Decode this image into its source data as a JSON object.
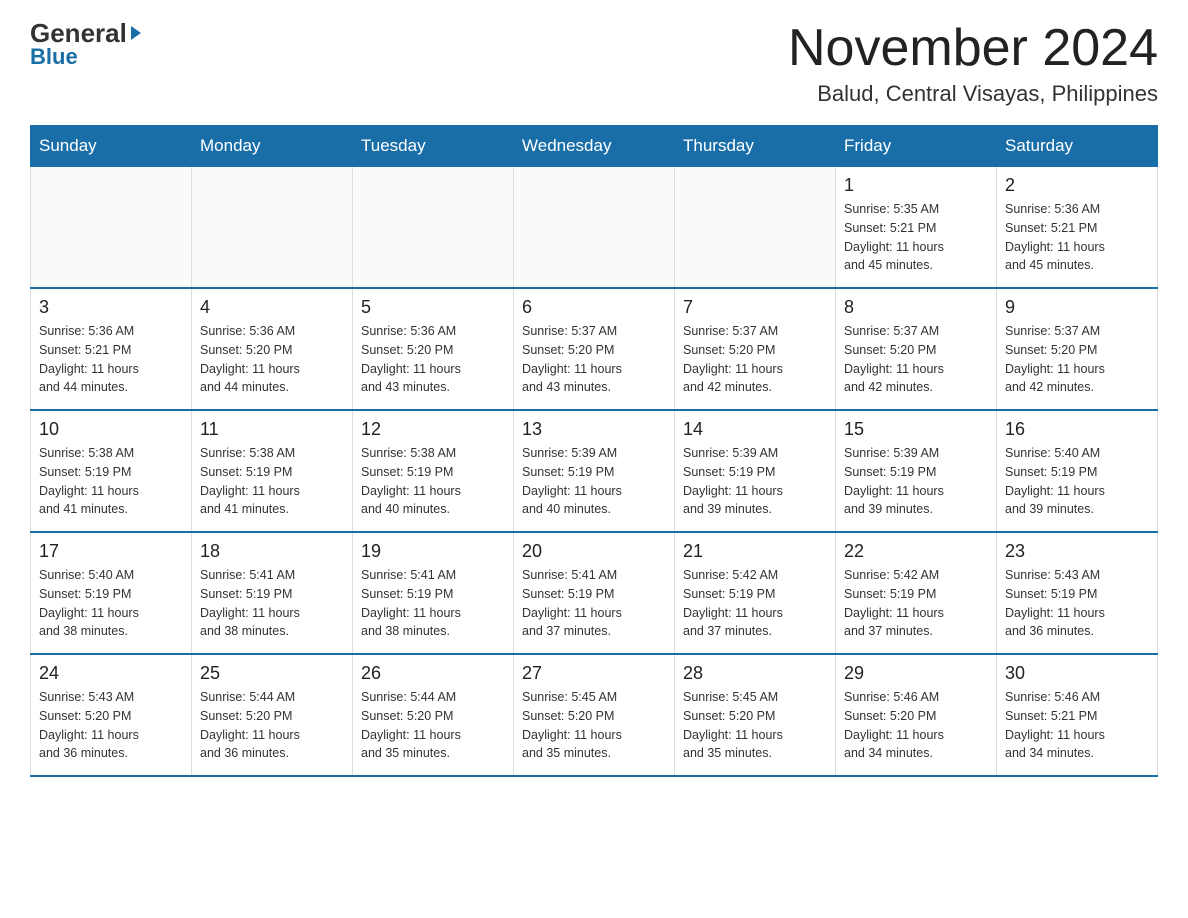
{
  "header": {
    "title": "November 2024",
    "subtitle": "Balud, Central Visayas, Philippines",
    "logo_general": "General",
    "logo_blue": "Blue"
  },
  "days_of_week": [
    "Sunday",
    "Monday",
    "Tuesday",
    "Wednesday",
    "Thursday",
    "Friday",
    "Saturday"
  ],
  "weeks": [
    [
      {
        "day": "",
        "info": ""
      },
      {
        "day": "",
        "info": ""
      },
      {
        "day": "",
        "info": ""
      },
      {
        "day": "",
        "info": ""
      },
      {
        "day": "",
        "info": ""
      },
      {
        "day": "1",
        "info": "Sunrise: 5:35 AM\nSunset: 5:21 PM\nDaylight: 11 hours\nand 45 minutes."
      },
      {
        "day": "2",
        "info": "Sunrise: 5:36 AM\nSunset: 5:21 PM\nDaylight: 11 hours\nand 45 minutes."
      }
    ],
    [
      {
        "day": "3",
        "info": "Sunrise: 5:36 AM\nSunset: 5:21 PM\nDaylight: 11 hours\nand 44 minutes."
      },
      {
        "day": "4",
        "info": "Sunrise: 5:36 AM\nSunset: 5:20 PM\nDaylight: 11 hours\nand 44 minutes."
      },
      {
        "day": "5",
        "info": "Sunrise: 5:36 AM\nSunset: 5:20 PM\nDaylight: 11 hours\nand 43 minutes."
      },
      {
        "day": "6",
        "info": "Sunrise: 5:37 AM\nSunset: 5:20 PM\nDaylight: 11 hours\nand 43 minutes."
      },
      {
        "day": "7",
        "info": "Sunrise: 5:37 AM\nSunset: 5:20 PM\nDaylight: 11 hours\nand 42 minutes."
      },
      {
        "day": "8",
        "info": "Sunrise: 5:37 AM\nSunset: 5:20 PM\nDaylight: 11 hours\nand 42 minutes."
      },
      {
        "day": "9",
        "info": "Sunrise: 5:37 AM\nSunset: 5:20 PM\nDaylight: 11 hours\nand 42 minutes."
      }
    ],
    [
      {
        "day": "10",
        "info": "Sunrise: 5:38 AM\nSunset: 5:19 PM\nDaylight: 11 hours\nand 41 minutes."
      },
      {
        "day": "11",
        "info": "Sunrise: 5:38 AM\nSunset: 5:19 PM\nDaylight: 11 hours\nand 41 minutes."
      },
      {
        "day": "12",
        "info": "Sunrise: 5:38 AM\nSunset: 5:19 PM\nDaylight: 11 hours\nand 40 minutes."
      },
      {
        "day": "13",
        "info": "Sunrise: 5:39 AM\nSunset: 5:19 PM\nDaylight: 11 hours\nand 40 minutes."
      },
      {
        "day": "14",
        "info": "Sunrise: 5:39 AM\nSunset: 5:19 PM\nDaylight: 11 hours\nand 39 minutes."
      },
      {
        "day": "15",
        "info": "Sunrise: 5:39 AM\nSunset: 5:19 PM\nDaylight: 11 hours\nand 39 minutes."
      },
      {
        "day": "16",
        "info": "Sunrise: 5:40 AM\nSunset: 5:19 PM\nDaylight: 11 hours\nand 39 minutes."
      }
    ],
    [
      {
        "day": "17",
        "info": "Sunrise: 5:40 AM\nSunset: 5:19 PM\nDaylight: 11 hours\nand 38 minutes."
      },
      {
        "day": "18",
        "info": "Sunrise: 5:41 AM\nSunset: 5:19 PM\nDaylight: 11 hours\nand 38 minutes."
      },
      {
        "day": "19",
        "info": "Sunrise: 5:41 AM\nSunset: 5:19 PM\nDaylight: 11 hours\nand 38 minutes."
      },
      {
        "day": "20",
        "info": "Sunrise: 5:41 AM\nSunset: 5:19 PM\nDaylight: 11 hours\nand 37 minutes."
      },
      {
        "day": "21",
        "info": "Sunrise: 5:42 AM\nSunset: 5:19 PM\nDaylight: 11 hours\nand 37 minutes."
      },
      {
        "day": "22",
        "info": "Sunrise: 5:42 AM\nSunset: 5:19 PM\nDaylight: 11 hours\nand 37 minutes."
      },
      {
        "day": "23",
        "info": "Sunrise: 5:43 AM\nSunset: 5:19 PM\nDaylight: 11 hours\nand 36 minutes."
      }
    ],
    [
      {
        "day": "24",
        "info": "Sunrise: 5:43 AM\nSunset: 5:20 PM\nDaylight: 11 hours\nand 36 minutes."
      },
      {
        "day": "25",
        "info": "Sunrise: 5:44 AM\nSunset: 5:20 PM\nDaylight: 11 hours\nand 36 minutes."
      },
      {
        "day": "26",
        "info": "Sunrise: 5:44 AM\nSunset: 5:20 PM\nDaylight: 11 hours\nand 35 minutes."
      },
      {
        "day": "27",
        "info": "Sunrise: 5:45 AM\nSunset: 5:20 PM\nDaylight: 11 hours\nand 35 minutes."
      },
      {
        "day": "28",
        "info": "Sunrise: 5:45 AM\nSunset: 5:20 PM\nDaylight: 11 hours\nand 35 minutes."
      },
      {
        "day": "29",
        "info": "Sunrise: 5:46 AM\nSunset: 5:20 PM\nDaylight: 11 hours\nand 34 minutes."
      },
      {
        "day": "30",
        "info": "Sunrise: 5:46 AM\nSunset: 5:21 PM\nDaylight: 11 hours\nand 34 minutes."
      }
    ]
  ]
}
